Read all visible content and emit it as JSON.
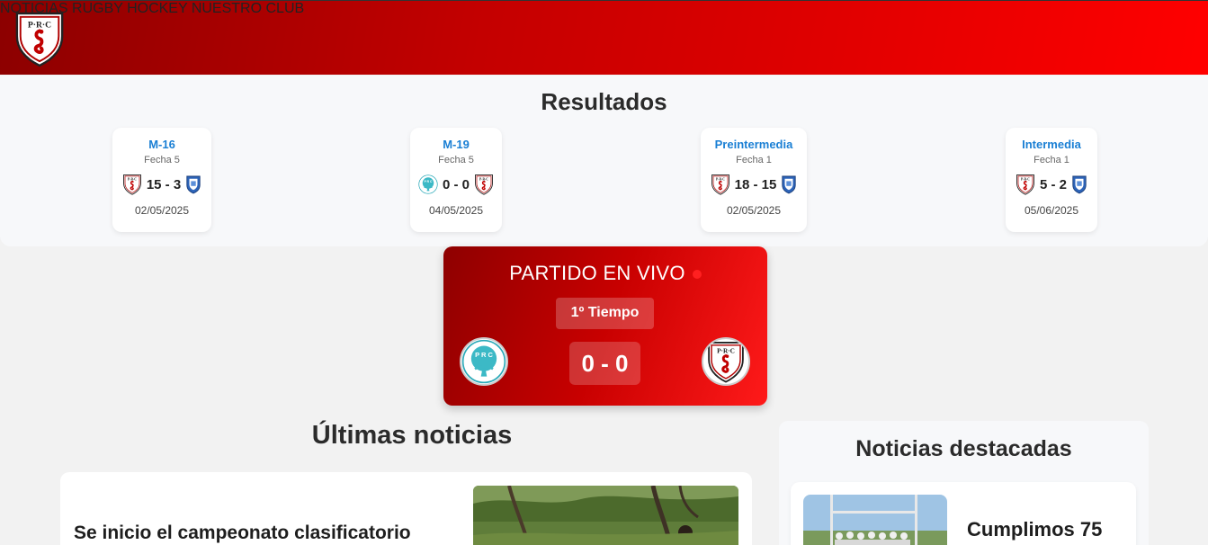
{
  "header": {
    "logo_text": "P·R·C",
    "nav": [
      {
        "label": "NOTICIAS"
      },
      {
        "label": "RUGBY"
      },
      {
        "label": "HOCKEY"
      },
      {
        "label": "NUESTRO CLUB"
      }
    ],
    "colors": {
      "dark": "#8c0000",
      "bright": "#ff0000"
    }
  },
  "results": {
    "title": "Resultados",
    "cards": [
      {
        "category": "M-16",
        "round": "Fecha 5",
        "score": "15 - 3",
        "date": "02/05/2025",
        "home_icon": "prc-crest-icon",
        "away_icon": "blue-shield-icon"
      },
      {
        "category": "M-19",
        "round": "Fecha 5",
        "score": "0 - 0",
        "date": "04/05/2025",
        "home_icon": "teal-crest-icon",
        "away_icon": "prc-crest-icon"
      },
      {
        "category": "Preintermedia",
        "round": "Fecha 1",
        "score": "18 - 15",
        "date": "02/05/2025",
        "home_icon": "prc-crest-icon",
        "away_icon": "blue-shield-icon"
      },
      {
        "category": "Intermedia",
        "round": "Fecha 1",
        "score": "5 - 2",
        "date": "05/06/2025",
        "home_icon": "prc-crest-icon",
        "away_icon": "blue-shield-icon"
      }
    ]
  },
  "live": {
    "title": "PARTIDO EN VIVO",
    "period": "1º Tiempo",
    "score": "0 - 0",
    "home_icon": "teal-crest-icon",
    "away_icon": "prc-crest-icon",
    "indicator_color": "#ff2020"
  },
  "news": {
    "title": "Últimas noticias",
    "items": [
      {
        "headline": "Se inicio el campeonato clasificatorio"
      }
    ]
  },
  "featured": {
    "title": "Noticias destacadas",
    "items": [
      {
        "headline": "Cumplimos 75"
      }
    ]
  }
}
